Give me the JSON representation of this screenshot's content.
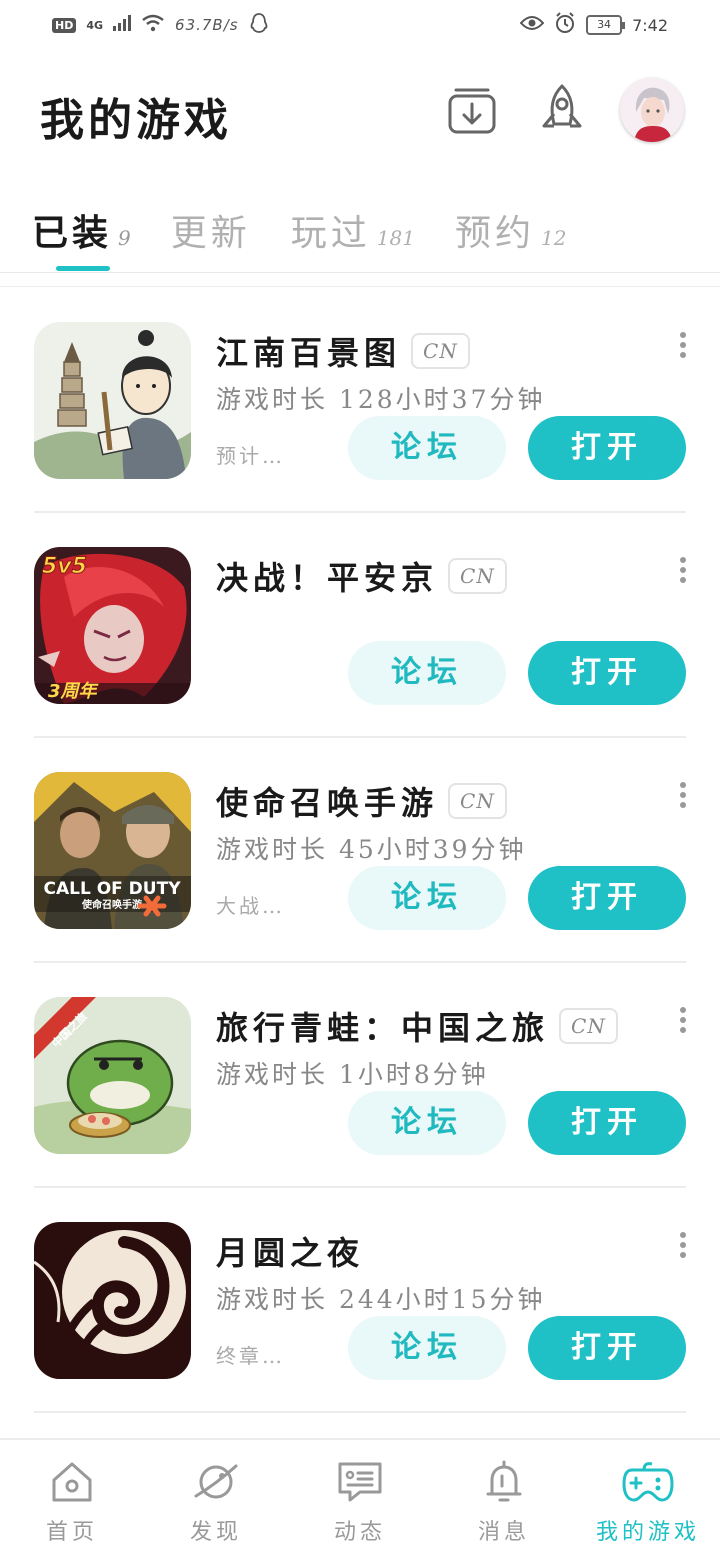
{
  "status_bar": {
    "hd": "HD",
    "network": "4G",
    "speed": "63.7B/s",
    "battery": "34",
    "time": "7:42"
  },
  "header": {
    "title": "我的游戏"
  },
  "tabs": [
    {
      "label": "已装",
      "count": "9",
      "active": true
    },
    {
      "label": "更新",
      "count": "",
      "active": false
    },
    {
      "label": "玩过",
      "count": "181",
      "active": false
    },
    {
      "label": "预约",
      "count": "12",
      "active": false
    }
  ],
  "games": [
    {
      "name": "江南百景图",
      "badge": "CN",
      "playtime": "游戏时长 128小时37分钟",
      "note": "预计…",
      "forum_label": "论坛",
      "open_label": "打开",
      "icon": "jiangnan-icon"
    },
    {
      "name": "决战！平安京",
      "badge": "CN",
      "playtime": "",
      "note": "",
      "forum_label": "论坛",
      "open_label": "打开",
      "icon": "onmyoji-arena-icon"
    },
    {
      "name": "使命召唤手游",
      "badge": "CN",
      "playtime": "游戏时长 45小时39分钟",
      "note": "大战…",
      "forum_label": "论坛",
      "open_label": "打开",
      "icon": "call-of-duty-icon"
    },
    {
      "name": "旅行青蛙：中国之旅",
      "badge": "CN",
      "playtime": "游戏时长 1小时8分钟",
      "note": "",
      "forum_label": "论坛",
      "open_label": "打开",
      "icon": "travel-frog-icon"
    },
    {
      "name": "月圆之夜",
      "badge": "",
      "playtime": "游戏时长 244小时15分钟",
      "note": "终章…",
      "forum_label": "论坛",
      "open_label": "打开",
      "icon": "full-moon-night-icon"
    }
  ],
  "icon_texts": {
    "fivev5": "5v5",
    "anniv": "3周年",
    "cod": "CALL OF DUTY",
    "cod_sub": "使命召唤手游",
    "frog_ribbon": "中国之旅"
  },
  "bottom_nav": [
    {
      "label": "首页",
      "icon": "home-icon",
      "active": false
    },
    {
      "label": "发现",
      "icon": "planet-icon",
      "active": false
    },
    {
      "label": "动态",
      "icon": "message-card-icon",
      "active": false
    },
    {
      "label": "消息",
      "icon": "bell-icon",
      "active": false
    },
    {
      "label": "我的游戏",
      "icon": "gamepad-icon",
      "active": true
    }
  ],
  "colors": {
    "accent": "#1fc0c6",
    "forum_bg": "#e9f8f8",
    "text": "#1a1a1a",
    "muted": "#888888"
  }
}
